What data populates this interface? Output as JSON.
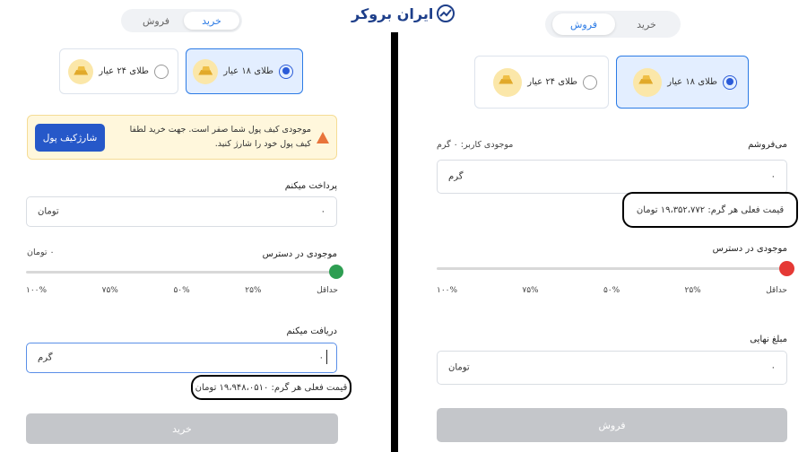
{
  "logo": {
    "text": "ایران بروکر",
    "icon": "chart-trend-icon"
  },
  "left": {
    "toggle": {
      "buy": "خرید",
      "sell": "فروش",
      "active": "buy"
    },
    "options": [
      {
        "label": "طلای ۱۸ عیار",
        "selected": true,
        "icon": "gold-bars-icon"
      },
      {
        "label": "طلای ۲۴ عیار",
        "selected": false,
        "icon": "gold-bars-icon"
      }
    ],
    "alert": {
      "text": "موجودی کیف پول شما صفر است. جهت خرید لطفا کیف پول خود را شارژ کنید.",
      "button": "شارژکیف پول",
      "icon": "warning-icon"
    },
    "pay_label": "پرداخت میکنم",
    "pay_value": "۰",
    "pay_unit": "تومان",
    "available_label": "موجودی در دسترس",
    "available_value": "۰ تومان",
    "slider_level": 0,
    "slider_color": "#2e9e52",
    "ticks": [
      "حداقل",
      "۲۵%",
      "۵۰%",
      "۷۵%",
      "۱۰۰%"
    ],
    "receive_label": "دریافت میکنم",
    "receive_value": "۰",
    "receive_unit": "گرم",
    "price_text": "قیمت فعلی هر گرم: ۱۹،۹۴۸،۰۵۱۰ تومان",
    "submit": "خرید"
  },
  "right": {
    "toggle": {
      "buy": "خرید",
      "sell": "فروش",
      "active": "sell"
    },
    "options": [
      {
        "label": "طلای ۱۸ عیار",
        "selected": true,
        "icon": "gold-bars-icon"
      },
      {
        "label": "طلای ۲۴ عیار",
        "selected": false,
        "icon": "gold-bars-icon"
      }
    ],
    "sell_label": "می‌فروشم",
    "user_balance": "موجودی کاربر: ۰ گرم",
    "sell_value": "۰",
    "sell_unit": "گرم",
    "price_text": "قیمت فعلی هر گرم: ۱۹،۳۵۲،۷۷۲ تومان",
    "available_label": "موجودی در دسترس",
    "slider_level": 0,
    "slider_color": "#e53935",
    "ticks": [
      "حداقل",
      "۲۵%",
      "۵۰%",
      "۷۵%",
      "۱۰۰%"
    ],
    "final_label": "مبلغ نهایی",
    "final_value": "۰",
    "final_unit": "تومان",
    "submit": "فروش"
  }
}
